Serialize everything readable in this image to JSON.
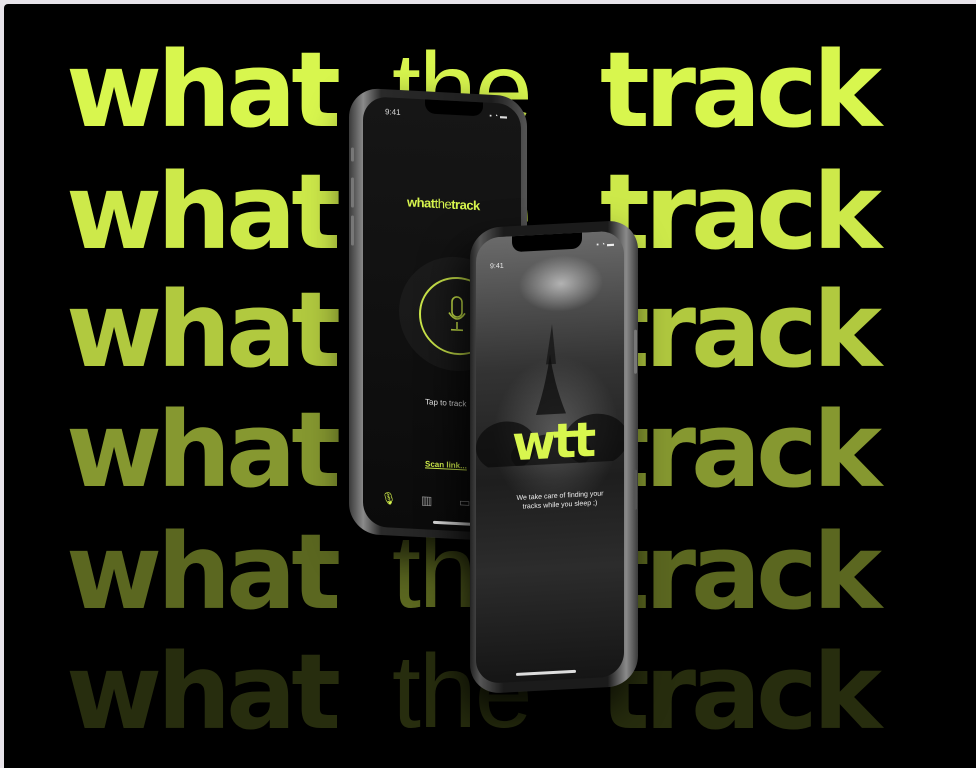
{
  "background": {
    "word1": "what",
    "word2": "the",
    "word3": "track",
    "accent": "#d8f64e"
  },
  "phone_back": {
    "time": "9:41",
    "status": "▪ ◔ ▬",
    "logo_what": "what",
    "logo_the": "the",
    "logo_track": "track",
    "tap_label": "Tap to track",
    "scan_label": "Scan link...",
    "tabs": [
      "mic-icon",
      "library-icon",
      "calendar-icon"
    ]
  },
  "phone_front": {
    "time": "9:41",
    "status": "▪ ◔ ▬",
    "logo": "wtt",
    "tagline": "We take care of finding your tracks while you sleep ;)"
  }
}
